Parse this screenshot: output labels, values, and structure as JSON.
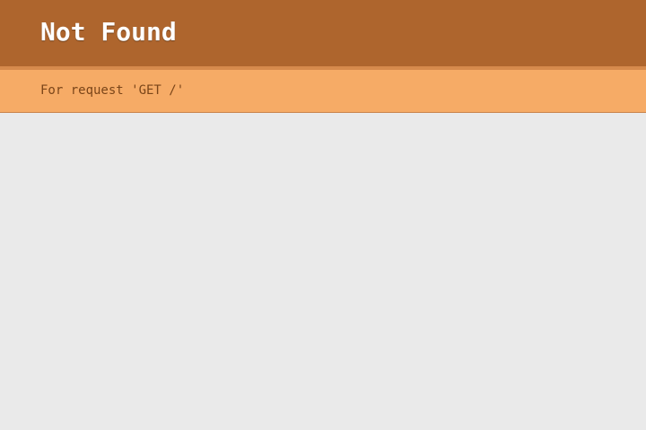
{
  "header": {
    "title": "Not Found"
  },
  "subheader": {
    "request_text": "For request 'GET /'"
  },
  "colors": {
    "header_bg": "#ae652d",
    "divider": "#d68a4c",
    "subheader_bg": "#f6ab66",
    "subheader_text": "#7a4519",
    "page_bg": "#eaeaea",
    "title_text": "#ffffff"
  }
}
